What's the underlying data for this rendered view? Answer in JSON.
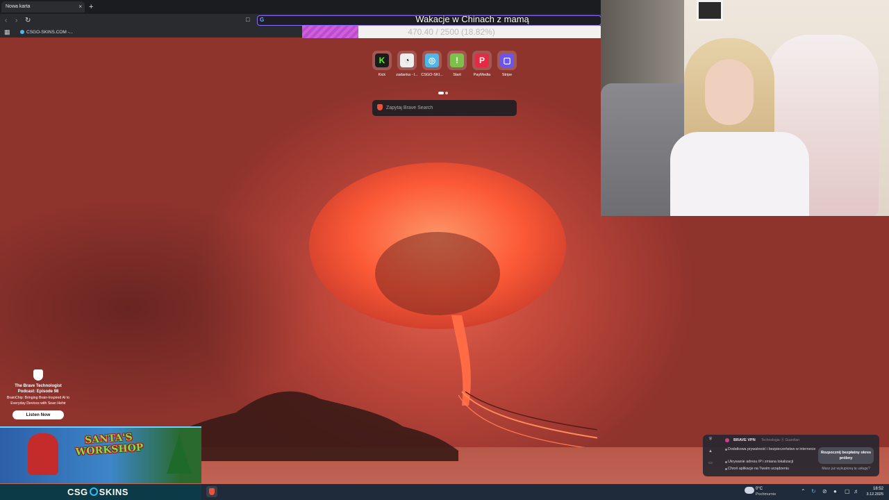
{
  "browser": {
    "tab_title": "Nowa karta",
    "tab_close": "×",
    "new_tab": "+",
    "bookmark_csgo": "CSGO-SKINS.COM -..."
  },
  "overlay": {
    "goal_title": "Wakacje w Chinach z mamą",
    "goal_progress_text": "470.40 / 2500 (18.82%)",
    "goal_fraction": 0.1882
  },
  "newtab": {
    "shortcuts": [
      {
        "label": "Kick",
        "icon": "kick-icon",
        "color": "#1b1b1b",
        "glyph": "K",
        "glyph_color": "#53fc18"
      },
      {
        "label": "zadanka - l...",
        "icon": "zadanka-icon",
        "color": "#eeeeee",
        "glyph": "◔",
        "glyph_color": "#222222"
      },
      {
        "label": "CSGO-SKI...",
        "icon": "csgo-skins-icon",
        "color": "#4fb6e8",
        "glyph": "◎",
        "glyph_color": "#ffffff"
      },
      {
        "label": "Start",
        "icon": "start-icon",
        "color": "#7cc24a",
        "glyph": "!",
        "glyph_color": "#ffffff"
      },
      {
        "label": "PayMedia",
        "icon": "paymedia-icon",
        "color": "#e52b44",
        "glyph": "P",
        "glyph_color": "#ffffff"
      },
      {
        "label": "Stripe",
        "icon": "stripe-icon",
        "color": "#6b55f0",
        "glyph": "▢",
        "glyph_color": "#ffffff"
      }
    ],
    "search_placeholder": "Zapytaj Brave Search"
  },
  "podcast": {
    "title": "The Brave Technologist Podcast: Episode 98",
    "description": "BrainChip: Bringing Brain-Inspired AI to Everyday Devices with Sean Hehir",
    "button": "Listen Now"
  },
  "ads": {
    "santa_title": "SANTA'S WORKSHOP",
    "csgo_left": "CSG",
    "csgo_right": "SKINS"
  },
  "vpn": {
    "name": "BRAVE VPN",
    "tech": "Technologia ⓖ Guardian",
    "items": [
      "Dodatkowa prywatność i bezpieczeństwo w internecie",
      "Ukrywanie adresu IP i zmiana lokalizacji",
      "Chroń aplikacje na Twoim urządzeniu"
    ],
    "cta": "Rozpocznij bezpłatny okres próbny",
    "have": "Masz już wykupioną tę usługę?"
  },
  "taskbar": {
    "weather_temp": "0°C",
    "weather_desc": "Pochmurnie",
    "time": "18:52",
    "date": "3.12.2025"
  }
}
